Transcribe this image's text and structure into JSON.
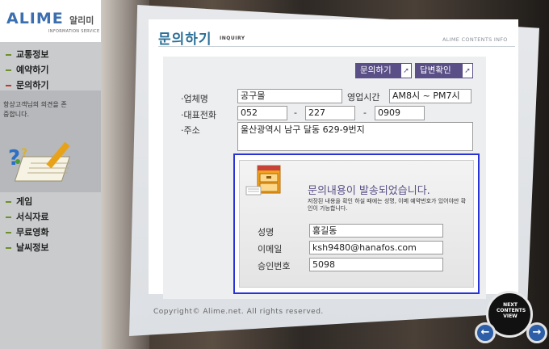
{
  "logo": {
    "brand": "ALIME",
    "korean": "알리미",
    "tagline": "INFORMATION SERVICE"
  },
  "sidebar": {
    "menu_top": [
      {
        "label": "교통정보",
        "active": false
      },
      {
        "label": "예약하기",
        "active": false
      },
      {
        "label": "문의하기",
        "active": true
      }
    ],
    "message": "항상고객님의 의견을 존중합니다.",
    "menu_bottom": [
      {
        "label": "게임"
      },
      {
        "label": "서식자료"
      },
      {
        "label": "무료영화"
      },
      {
        "label": "날씨정보"
      }
    ]
  },
  "header": {
    "title": "문의하기",
    "subtitle": "INQUIRY",
    "brand_info": "ALIME CONTENTS INFO"
  },
  "buttons": {
    "inquiry": "문의하기",
    "answer_check": "답변확인",
    "arrow": "➚"
  },
  "form": {
    "company_label": "·업체명",
    "company_value": "공구몰",
    "hours_label": "영업시간",
    "hours_value": "AM8시 ~ PM7시",
    "phone_label": "·대표전화",
    "phone_1": "052",
    "phone_2": "227",
    "phone_3": "0909",
    "phone_sep": "-",
    "address_label": "·주소",
    "address_value": "울산광역시 남구 달동 629-9번지"
  },
  "confirm": {
    "title": "문의내용이 발송되었습니다.",
    "message": "저장된 내용을 확인 하실 때에는 성명, 이메 예약번호가 있어야만 확인이 가능합니다.",
    "name_label": "성명",
    "name_value": "홍길동",
    "email_label": "이메일",
    "email_value": "ksh9480@hanafos.com",
    "code_label": "승인번호",
    "code_value": "5098"
  },
  "footer": {
    "copyright": "Copyright© Alime.net. All rights reserved."
  },
  "nav_widget": {
    "text": "NEXT CONTENTS VIEW",
    "prev": "←",
    "next": "→"
  }
}
